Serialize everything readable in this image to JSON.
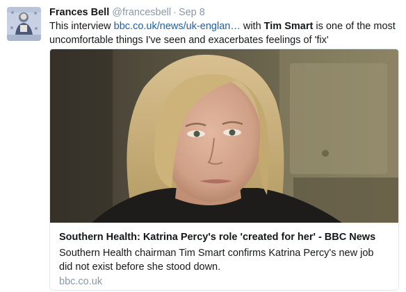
{
  "tweet": {
    "display_name": "Frances Bell",
    "handle": "@francesbell",
    "separator": "·",
    "timestamp": "Sep 8",
    "text_prefix": "This interview ",
    "link_text": "bbc.co.uk/news/uk-englan…",
    "text_middle": " with ",
    "mention": "Tim Smart",
    "text_suffix": " is one of the most uncomfortable things I've seen and exacerbates feelings of 'fix'"
  },
  "card": {
    "title": "Southern Health: Katrina Percy's role 'created for her' - BBC News",
    "description": "Southern Health chairman Tim Smart confirms Katrina Percy's new job did not exist before she stood down.",
    "domain": "bbc.co.uk"
  },
  "colors": {
    "text": "#14171a",
    "secondary": "#8899a6",
    "link": "#1b5fa8",
    "border": "#e1e8ed"
  }
}
